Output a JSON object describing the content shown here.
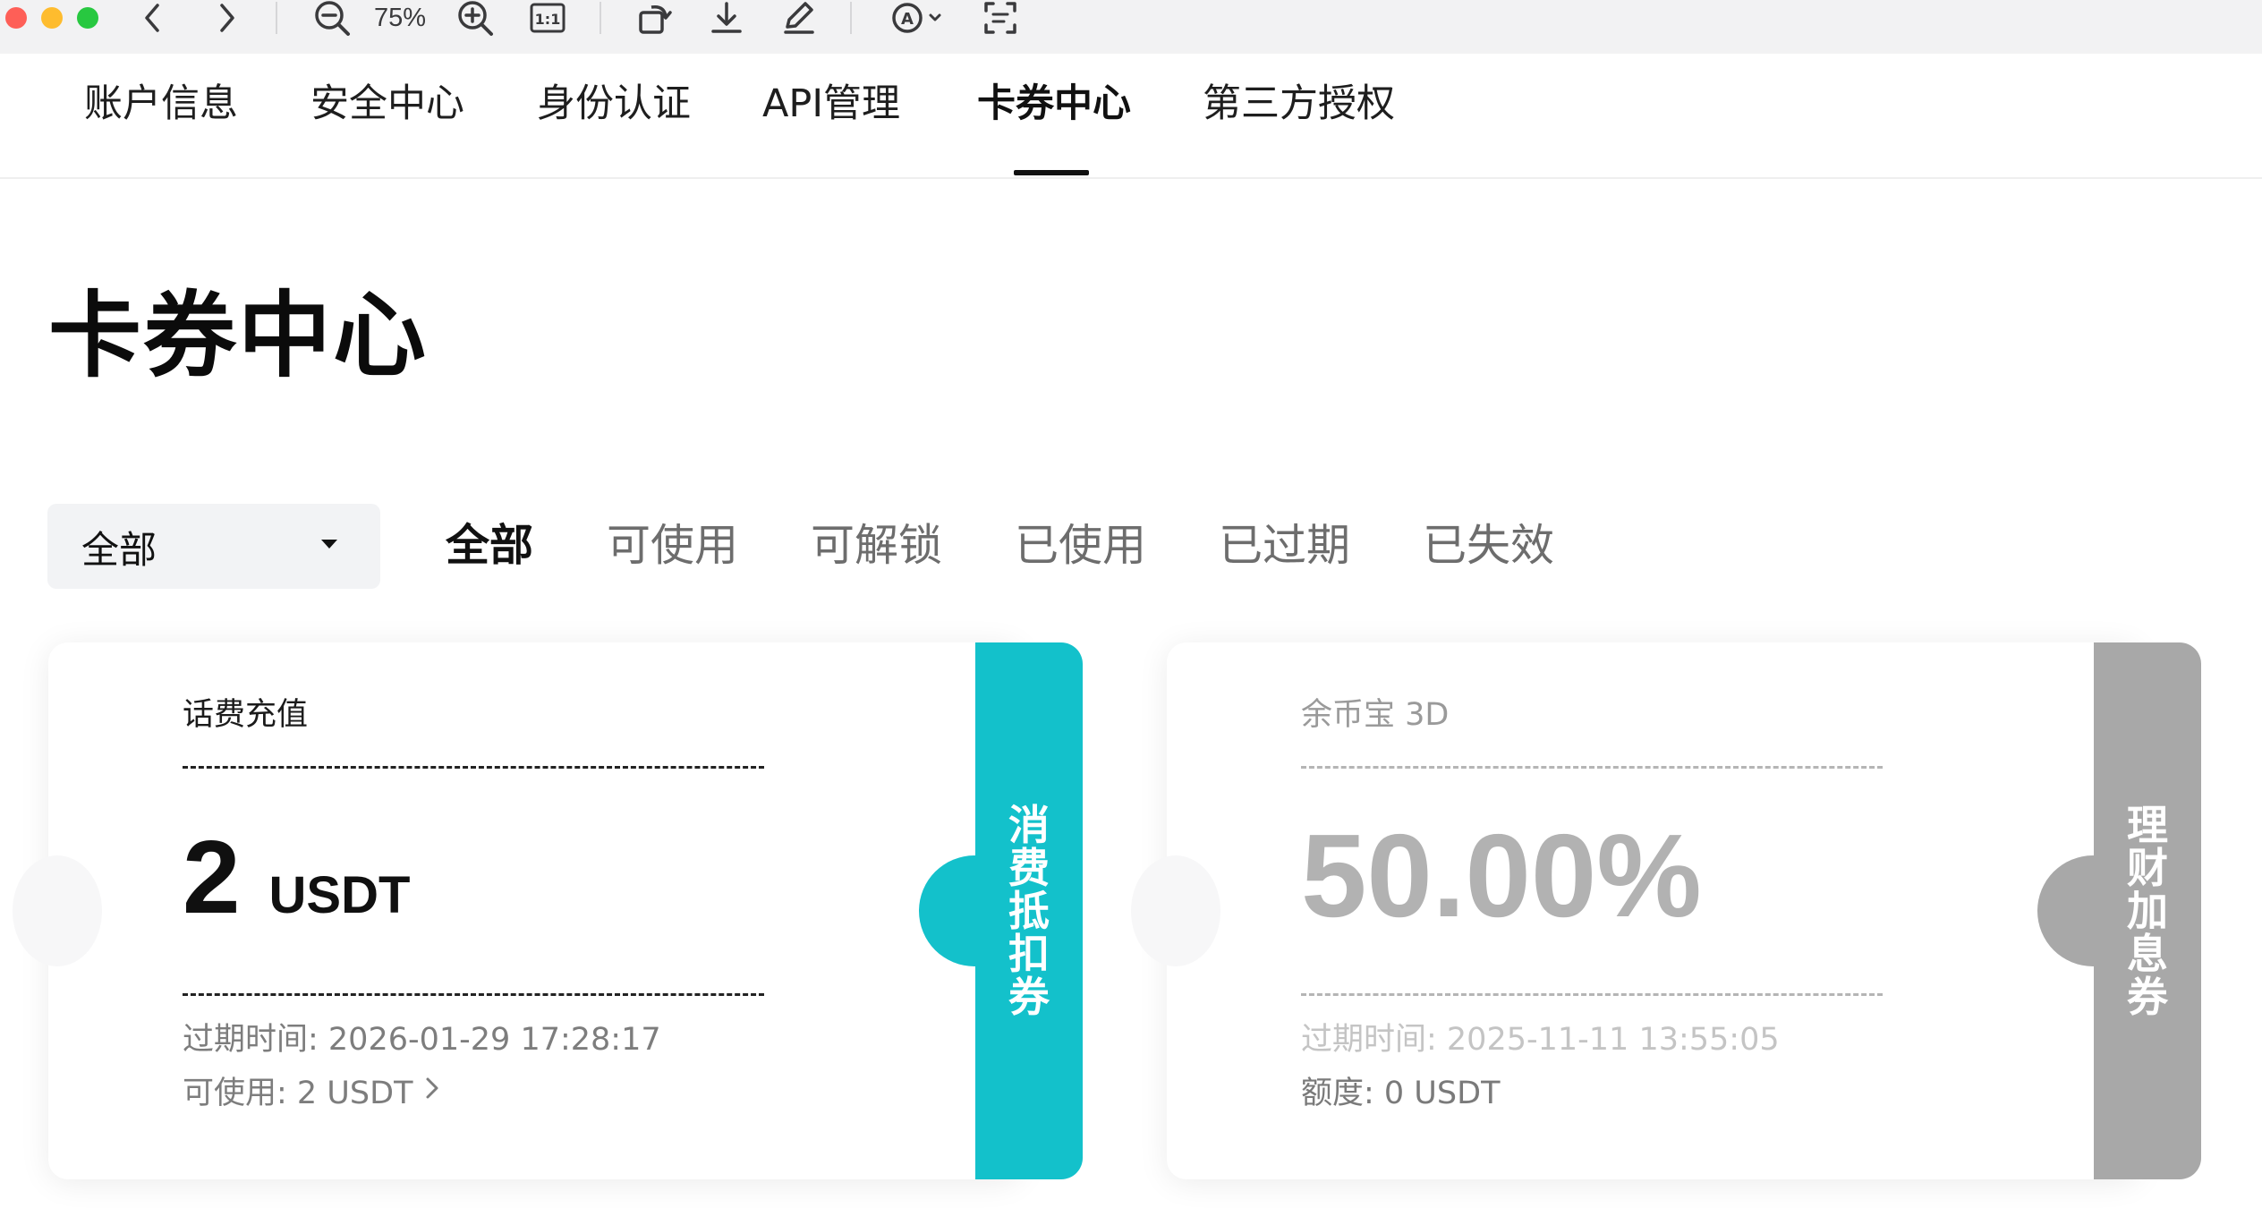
{
  "toolbar": {
    "zoom": "75%",
    "icons": [
      "chevron-left-icon",
      "chevron-right-icon",
      "zoom-out-icon",
      "zoom-in-icon",
      "actual-size-icon",
      "rotate-icon",
      "download-icon",
      "annotate-icon",
      "markup-icon",
      "scan-text-icon"
    ]
  },
  "tabs": [
    {
      "label": "账户信息",
      "active": false
    },
    {
      "label": "安全中心",
      "active": false
    },
    {
      "label": "身份认证",
      "active": false
    },
    {
      "label": "API管理",
      "active": false
    },
    {
      "label": "卡券中心",
      "active": true
    },
    {
      "label": "第三方授权",
      "active": false
    }
  ],
  "page": {
    "title": "卡券中心"
  },
  "filter": {
    "select_value": "全部",
    "status_tabs": [
      {
        "label": "全部",
        "active": true
      },
      {
        "label": "可使用",
        "active": false
      },
      {
        "label": "可解锁",
        "active": false
      },
      {
        "label": "已使用",
        "active": false
      },
      {
        "label": "已过期",
        "active": false
      },
      {
        "label": "已失效",
        "active": false
      }
    ]
  },
  "cards": [
    {
      "title": "话费充值",
      "amount": "2",
      "unit": "USDT",
      "expire": "过期时间: 2026-01-29 17:28:17",
      "footer": "可使用: 2 USDT",
      "type_label": "消费抵扣券",
      "strip_color": "#13c1cb",
      "status": "active"
    },
    {
      "title": "余币宝 3D",
      "amount": "50.00%",
      "unit": "",
      "expire": "过期时间: 2025-11-11 13:55:05",
      "footer": "额度: 0 USDT",
      "type_label": "理财加息券",
      "strip_color": "#a8a8a8",
      "status": "inactive"
    }
  ]
}
